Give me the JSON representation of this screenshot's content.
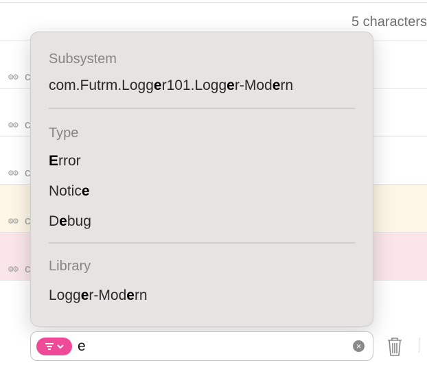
{
  "header": {
    "char_count": "5 characters"
  },
  "rows": [
    {
      "text": "c",
      "level": "default"
    },
    {
      "text": "c",
      "level": "default"
    },
    {
      "text": "c",
      "level": "default"
    },
    {
      "text": "c",
      "level": "notice"
    },
    {
      "text": "c",
      "level": "error"
    }
  ],
  "colors": {
    "notice_row": "#fdf6e6",
    "error_row": "#fae6e8",
    "filter_accent": "#ef4a98",
    "popup_bg": "#e7e3e2"
  },
  "popup": {
    "sections": [
      {
        "title": "Subsystem",
        "items": [
          [
            {
              "t": "com.Futrm.Logg"
            },
            {
              "t": "e",
              "hl": true
            },
            {
              "t": "r101.Logg"
            },
            {
              "t": "e",
              "hl": true
            },
            {
              "t": "r-Mod"
            },
            {
              "t": "e",
              "hl": true
            },
            {
              "t": "rn"
            }
          ]
        ]
      },
      {
        "title": "Type",
        "items": [
          [
            {
              "t": "E",
              "hl": true
            },
            {
              "t": "rror"
            }
          ],
          [
            {
              "t": "Notic"
            },
            {
              "t": "e",
              "hl": true
            }
          ],
          [
            {
              "t": "D"
            },
            {
              "t": "e",
              "hl": true
            },
            {
              "t": "bug"
            }
          ]
        ]
      },
      {
        "title": "Library",
        "items": [
          [
            {
              "t": "Logg"
            },
            {
              "t": "e",
              "hl": true
            },
            {
              "t": "r-Mod"
            },
            {
              "t": "e",
              "hl": true
            },
            {
              "t": "rn"
            }
          ]
        ]
      }
    ]
  },
  "search": {
    "value": "e",
    "icons": [
      "filter-icon",
      "chevron-down-icon",
      "clear-icon"
    ]
  },
  "toolbar": {
    "icons": [
      "trash-icon"
    ]
  }
}
